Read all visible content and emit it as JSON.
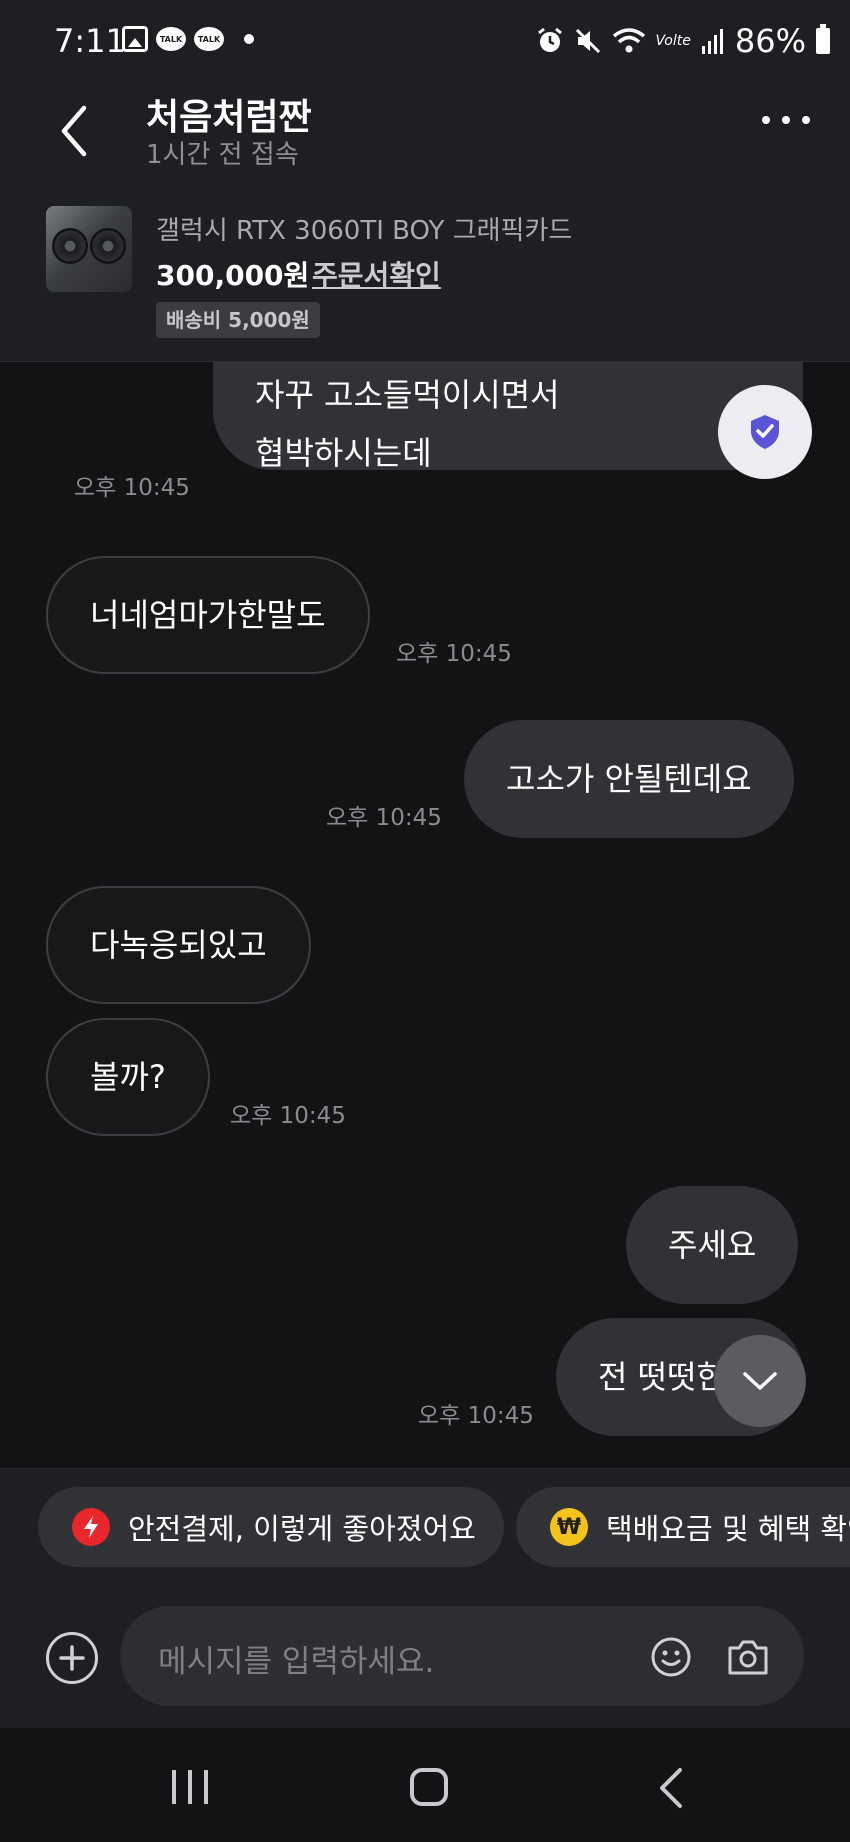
{
  "status_bar": {
    "time": "7:11",
    "notif_talk_1": "TALK",
    "notif_talk_2": "TALK",
    "volte": "Volte",
    "battery": "86%"
  },
  "header": {
    "title": "처음처럼짠",
    "subtitle": "1시간 전 접속"
  },
  "product": {
    "name": "갤럭시 RTX 3060TI BOY 그래픽카드",
    "price": "300,000원",
    "order_link": "주문서확인",
    "shipping": "배송비 5,000원"
  },
  "messages": [
    {
      "side": "out",
      "text_line1": "자꾸 고소들먹이시면서",
      "text_line2": "협박하시는데",
      "time": "오후 10:45"
    },
    {
      "side": "in",
      "text": "너네엄마가한말도",
      "time": "오후 10:45"
    },
    {
      "side": "out",
      "text": "고소가 안될텐데요",
      "time": "오후 10:45"
    },
    {
      "side": "in",
      "text": "다녹응되있고"
    },
    {
      "side": "in",
      "text": "볼까?",
      "time": "오후 10:45"
    },
    {
      "side": "out",
      "text": "주세요"
    },
    {
      "side": "out",
      "text": "전 떳떳한",
      "time": "오후 10:45"
    }
  ],
  "chips": [
    {
      "label": "안전결제, 이렇게 좋아졌어요",
      "icon": "lightning-icon",
      "color": "#e8262b"
    },
    {
      "label": "택배요금 및 혜택 확인",
      "icon": "won-icon",
      "color": "#f3c21b"
    }
  ],
  "input": {
    "placeholder": "메시지를 입력하세요."
  },
  "colors": {
    "background": "#121315",
    "header_bg": "#1e1f22",
    "bubble_out": "#313236",
    "bubble_in_border": "#3d3e42",
    "shield_accent": "#5b55d6"
  }
}
